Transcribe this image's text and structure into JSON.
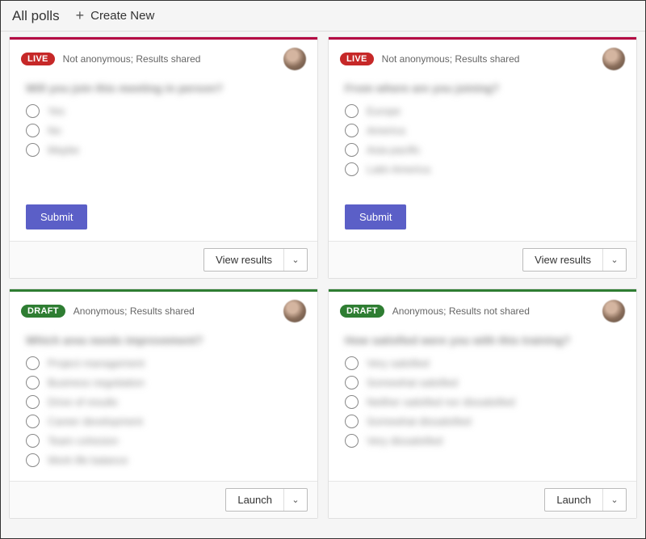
{
  "header": {
    "title": "All polls",
    "create_new_label": "Create New"
  },
  "buttons": {
    "submit": "Submit",
    "view_results": "View results",
    "launch": "Launch"
  },
  "badges": {
    "live": "LIVE",
    "draft": "DRAFT"
  },
  "cards": [
    {
      "status": "live",
      "meta": "Not anonymous; Results shared",
      "question": "Will you join this meeting in person?",
      "options": [
        "Yes",
        "No",
        "Maybe"
      ],
      "action": "view_results",
      "show_submit": true
    },
    {
      "status": "live",
      "meta": "Not anonymous; Results shared",
      "question": "From where are you joining?",
      "options": [
        "Europe",
        "America",
        "Asia-pacific",
        "Latin America"
      ],
      "action": "view_results",
      "show_submit": true
    },
    {
      "status": "draft",
      "meta": "Anonymous; Results shared",
      "question": "Which area needs improvement?",
      "options": [
        "Project management",
        "Business negotiation",
        "Drive of results",
        "Career development",
        "Team cohesion",
        "Work life balance"
      ],
      "action": "launch",
      "show_submit": false
    },
    {
      "status": "draft",
      "meta": "Anonymous; Results not shared",
      "question": "How satisfied were you with this training?",
      "options": [
        "Very satisfied",
        "Somewhat satisfied",
        "Neither satisfied nor dissatisfied",
        "Somewhat dissatisfied",
        "Very dissatisfied"
      ],
      "action": "launch",
      "show_submit": false
    }
  ]
}
